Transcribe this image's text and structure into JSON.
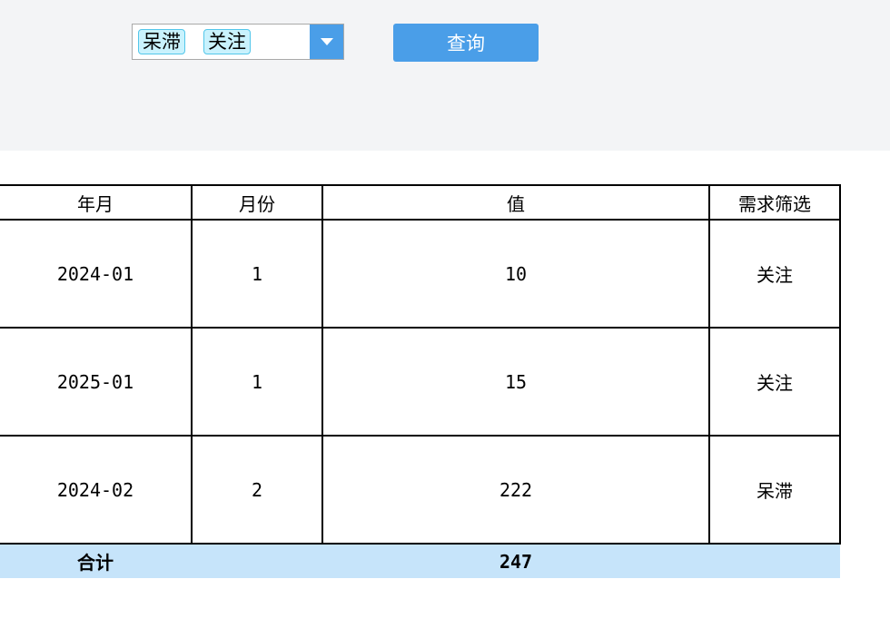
{
  "filter": {
    "chips": [
      "呆滞",
      "关注"
    ],
    "query_label": "查询"
  },
  "table": {
    "headers": [
      "年月",
      "月份",
      "值",
      "需求筛选"
    ],
    "rows": [
      [
        "2024-01",
        "1",
        "10",
        "关注"
      ],
      [
        "2025-01",
        "1",
        "15",
        "关注"
      ],
      [
        "2024-02",
        "2",
        "222",
        "呆滞"
      ]
    ],
    "total_label": "合计",
    "total_value": "247"
  },
  "colors": {
    "accent": "#4a9ee8",
    "chip_bg": "#c9f2fd",
    "total_row_bg": "#c6e4fa",
    "toolbar_bg": "#f3f4f6"
  }
}
